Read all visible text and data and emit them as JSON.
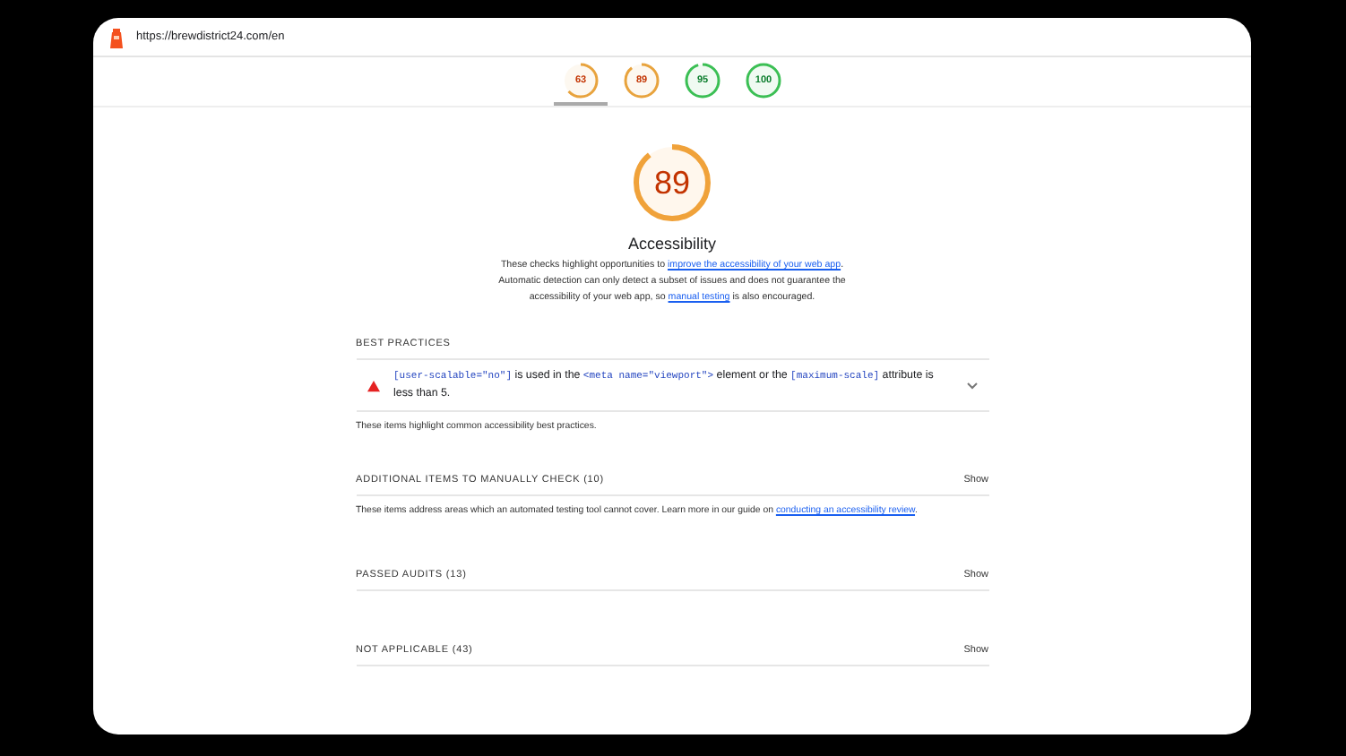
{
  "address_bar": {
    "url": "https://brewdistrict24.com/en"
  },
  "score_tabs": [
    {
      "score": "63",
      "color": "#e8a33d",
      "selected": true
    },
    {
      "score": "89",
      "color": "#e8a33d",
      "selected": false
    },
    {
      "score": "95",
      "color": "#3bbf54",
      "selected": false
    },
    {
      "score": "100",
      "color": "#3bbf54",
      "selected": false
    }
  ],
  "category": {
    "score": "89",
    "title": "Accessibility",
    "description": [
      {
        "kind": "text",
        "text": "These checks highlight opportunities to "
      },
      {
        "kind": "link",
        "text": "improve the accessibility of your web app"
      },
      {
        "kind": "text",
        "text": ". Automatic detection can only detect a subset of issues and does not guarantee the accessibility of your web app, so "
      },
      {
        "kind": "link",
        "text": "manual testing"
      },
      {
        "kind": "text",
        "text": " is also encouraged."
      }
    ]
  },
  "best_practices": {
    "heading": "BEST PRACTICES",
    "audits": [
      {
        "parts": [
          {
            "kind": "code",
            "text": "[user-scalable=\"no\"]"
          },
          {
            "kind": "text",
            "text": " is used in the "
          },
          {
            "kind": "code",
            "text": "<meta name=\"viewport\">"
          },
          {
            "kind": "text",
            "text": " element or the "
          },
          {
            "kind": "code",
            "text": "[maximum-scale]"
          },
          {
            "kind": "text",
            "text": " attribute is less than 5."
          }
        ],
        "expanded": false
      }
    ],
    "note": "These items highlight common accessibility best practices."
  },
  "groups": [
    {
      "heading": "ADDITIONAL ITEMS TO MANUALLY CHECK (10)",
      "toggle": "Show",
      "note": [
        {
          "kind": "text",
          "text": "These items address areas which an automated testing tool cannot cover. Learn more in our guide on "
        },
        {
          "kind": "link",
          "text": "conducting an accessibility review"
        },
        {
          "kind": "text",
          "text": "."
        }
      ]
    },
    {
      "heading": "PASSED AUDITS (13)",
      "toggle": "Show"
    },
    {
      "heading": "NOT APPLICABLE (43)",
      "toggle": "Show"
    }
  ]
}
